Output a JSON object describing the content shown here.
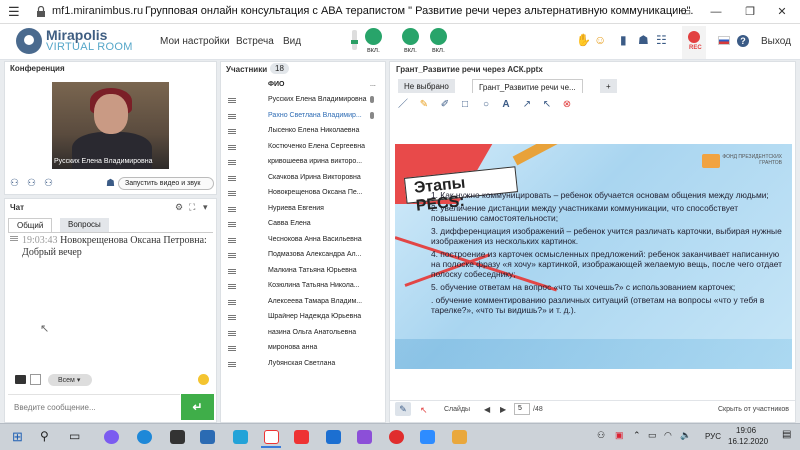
{
  "browser": {
    "url": "mf1.miranimbus.ru",
    "title": "Групповая онлайн консультация с АВА терапистом \" Развитие речи через альтернативную коммуникацию\"."
  },
  "header": {
    "logo_line1": "Mirapolis",
    "logo_line2": "VIRTUAL ROOM",
    "menu": [
      "Мои настройки",
      "Встреча",
      "Вид"
    ],
    "toggles": [
      {
        "icon": "mic-icon",
        "label": "вкл."
      },
      {
        "icon": "camera-icon",
        "label": "вкл."
      },
      {
        "icon": "speaker-icon",
        "label": "вкл."
      }
    ],
    "rec_label": "REC",
    "exit_label": "Выход"
  },
  "conference": {
    "title": "Конференция",
    "video_caption": "Русских Елена Владимировна",
    "start_video_button": "Запустить видео и звук"
  },
  "chat": {
    "title": "Чат",
    "tabs": [
      "Общий",
      "Вопросы"
    ],
    "messages": [
      {
        "time": "19:03:43",
        "author": "Новокрещенова  Оксана Петровна:",
        "text": "Добрый вечер"
      }
    ],
    "recipient": "Всем",
    "input_placeholder": "Введите сообщение..."
  },
  "participants": {
    "title": "Участники",
    "count": "18",
    "column": "ФИО",
    "more": "...",
    "list": [
      "Русских Елена Владимировна",
      "Рахно Светлана  Владимир...",
      "Лысенко Елена  Николаевна",
      "Костюченко  Елена Сергеевна",
      "кривошеева  ирина викторо...",
      "Скачкова  Ирина Викторовна",
      "Новокрещенова  Оксана Пе...",
      "Нуриева Евгения",
      "Савва  Елена",
      "Чеснокова  Анна  Васильевна",
      "Подмазова  Александра Ал...",
      "Малкина Татьяна  Юрьевна",
      "Козюлина  Татьяна Никола...",
      "Алексеева  Тамара  Владим...",
      "Шрайнер Надежда Юрьевна",
      "назина  Ольга Анатольевна",
      "миронова  анна",
      "Лубянская  Светлана"
    ]
  },
  "whiteboard": {
    "title": "Грант_Развитие речи через АСК.pptx",
    "tabs": [
      "Не выбрано",
      "Грант_Развитие речи че...",
      "+"
    ],
    "slide": {
      "heading": "Этапы PECS:",
      "fund": "ФОНД ПРЕЗИДЕНТСКИХ ГРАНТОВ",
      "items": [
        "1. Как нужно коммуницировать – ребенок обучается основам общения между людьми;",
        "2. увеличение дистанции между участниками коммуникации, что способствует повышению самостоятельности;",
        "3. дифференциация изображений – ребенок учится различать карточки, выбирая нужные изображения из нескольких картинок.",
        "4. построение из карточек осмысленных предложений: ребенок заканчивает написанную на полоске фразу «я хочу» картинкой, изображающей желаемую вещь, после чего отдает полоску собеседнику;",
        "5. обучение ответам на вопрос «что ты хочешь?» с использованием карточек;",
        ". обучение комментированию различных ситуаций (ответам на вопросы «что у тебя в тарелке?», «что ты видишь?» и т. д.)."
      ]
    },
    "footer": {
      "slides_label": "Слайды",
      "current_page": "5",
      "total_pages": "/48",
      "hide_label": "Скрыть от участников"
    }
  },
  "taskbar": {
    "time": "19:06",
    "date": "16.12.2020",
    "lang": "РУС"
  },
  "colors": {
    "accent_green": "#28a46a",
    "rec_red": "#e24040",
    "send_green": "#3fae49",
    "brand_blue": "#3f5e82"
  }
}
